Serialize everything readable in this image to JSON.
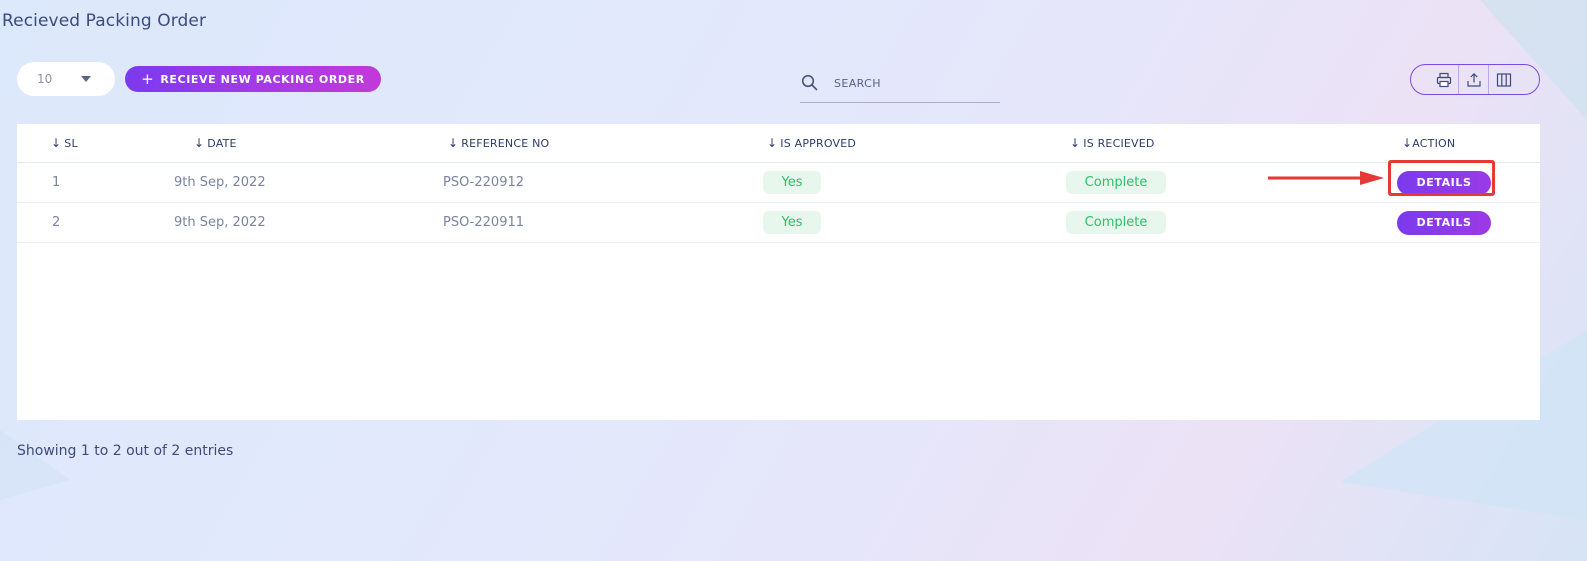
{
  "page": {
    "title": "Recieved Packing Order"
  },
  "toolbar": {
    "page_size": "10",
    "new_button_label": "RECIEVE NEW PACKING ORDER",
    "search_placeholder": "SEARCH",
    "search_value": "",
    "tools": [
      {
        "icon": "printer-icon"
      },
      {
        "icon": "export-icon"
      },
      {
        "icon": "columns-icon"
      }
    ]
  },
  "table": {
    "columns": [
      {
        "key": "sl",
        "label": "SL"
      },
      {
        "key": "date",
        "label": "DATE"
      },
      {
        "key": "reference",
        "label": "REFERENCE NO"
      },
      {
        "key": "approved",
        "label": "IS APPROVED"
      },
      {
        "key": "received",
        "label": "IS RECIEVED"
      },
      {
        "key": "action",
        "label": "ACTION"
      }
    ],
    "rows": [
      {
        "sl": "1",
        "date": "9th Sep, 2022",
        "reference": "PSO-220912",
        "approved": "Yes",
        "received": "Complete",
        "action": "DETAILS"
      },
      {
        "sl": "2",
        "date": "9th Sep, 2022",
        "reference": "PSO-220911",
        "approved": "Yes",
        "received": "Complete",
        "action": "DETAILS"
      }
    ]
  },
  "footer": {
    "info": "Showing 1 to 2 out of 2 entries"
  },
  "colors": {
    "accent": "#7c3aed",
    "accent_end": "#c23ad8",
    "success_text": "#2fbf68",
    "success_bg": "#e8f7ee",
    "annotation": "#e53935"
  }
}
